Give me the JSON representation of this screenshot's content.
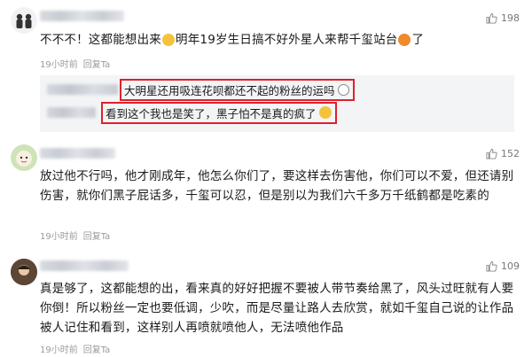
{
  "comments": [
    {
      "likes": "198",
      "text_a": "不不不！这都能想出来",
      "text_b": "明年19岁生日搞不好外星人来帮千玺站台",
      "text_c": "了",
      "time": "19小时前",
      "reply": "回复Ta",
      "replies": [
        {
          "text": "大明星还用吸连花呗都还不起的粉丝的运吗"
        },
        {
          "text": "看到这个我也是笑了，黑子怕不是真的疯了"
        }
      ]
    },
    {
      "likes": "152",
      "text": "放过他不行吗，他才刚成年，他怎么你们了，要这样去伤害他，你们可以不爱，但还请别伤害，就你们黑子屁话多，千玺可以忍，但是别以为我们六千多万千纸鹤都是吃素的",
      "time": "19小时前",
      "reply": "回复Ta"
    },
    {
      "likes": "109",
      "text": "真是够了，这都能想的出，看来真的好好把握不要被人带节奏给黑了，风头过旺就有人要你倒！所以粉丝一定也要低调，少吹，而是尽量让路人去欣赏，就如千玺自己说的让作品被人记住和看到，这样别人再喷就喷他人，无法喷他作品",
      "time": "19小时前",
      "reply": "回复Ta"
    }
  ],
  "colors": {
    "highlight_border": "#e0202a",
    "meta": "#9a9a9a"
  },
  "icons": [
    "avatar",
    "thumbs-up-icon",
    "smile-emoji",
    "angry-emoji"
  ]
}
